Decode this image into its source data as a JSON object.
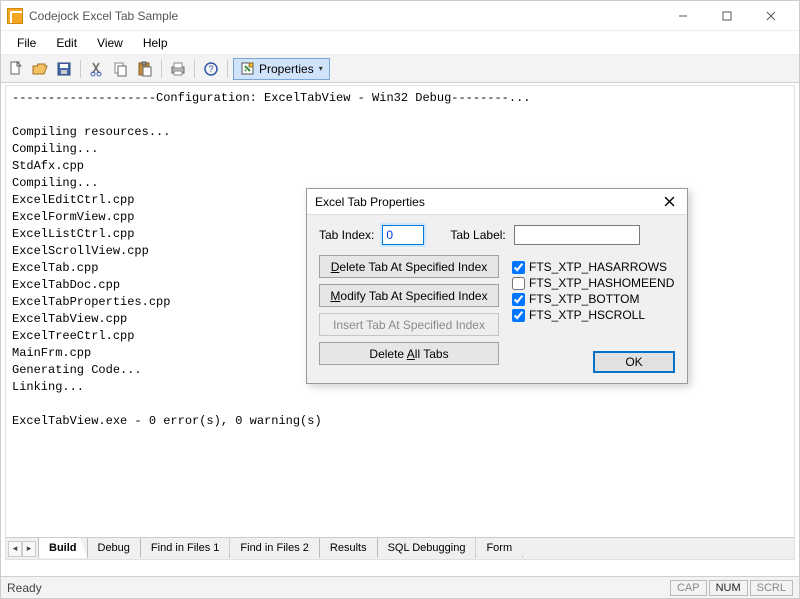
{
  "window": {
    "title": "Codejock Excel Tab Sample"
  },
  "menus": {
    "file": "File",
    "edit": "Edit",
    "view": "View",
    "help": "Help"
  },
  "toolbar": {
    "properties_label": "Properties"
  },
  "output_lines": [
    "--------------------Configuration: ExcelTabView - Win32 Debug--------...",
    "",
    "Compiling resources...",
    "Compiling...",
    "StdAfx.cpp",
    "Compiling...",
    "ExcelEditCtrl.cpp",
    "ExcelFormView.cpp",
    "ExcelListCtrl.cpp",
    "ExcelScrollView.cpp",
    "ExcelTab.cpp",
    "ExcelTabDoc.cpp",
    "ExcelTabProperties.cpp",
    "ExcelTabView.cpp",
    "ExcelTreeCtrl.cpp",
    "MainFrm.cpp",
    "Generating Code...",
    "Linking...",
    "",
    "ExcelTabView.exe - 0 error(s), 0 warning(s)"
  ],
  "tabs": [
    {
      "label": "Build",
      "active": true
    },
    {
      "label": "Debug",
      "active": false
    },
    {
      "label": "Find in Files 1",
      "active": false
    },
    {
      "label": "Find in Files 2",
      "active": false
    },
    {
      "label": "Results",
      "active": false
    },
    {
      "label": "SQL Debugging",
      "active": false
    },
    {
      "label": "Form",
      "active": false
    }
  ],
  "status": {
    "text": "Ready",
    "indicators": {
      "cap": "CAP",
      "num": "NUM",
      "scrl": "SCRL"
    },
    "num_active": true
  },
  "dialog": {
    "title": "Excel Tab Properties",
    "tab_index_label": "Tab Index:",
    "tab_index_value": "0",
    "tab_label_label": "Tab Label:",
    "tab_label_value": "",
    "btn_delete": "Delete Tab At Specified Index",
    "btn_modify": "Modify Tab At Specified Index",
    "btn_insert": "Insert Tab At Specified Index",
    "btn_delete_all": "Delete All Tabs",
    "btn_ok": "OK",
    "checks": [
      {
        "label": "FTS_XTP_HASARROWS",
        "checked": true
      },
      {
        "label": "FTS_XTP_HASHOMEEND",
        "checked": false
      },
      {
        "label": "FTS_XTP_BOTTOM",
        "checked": true
      },
      {
        "label": "FTS_XTP_HSCROLL",
        "checked": true
      }
    ]
  }
}
